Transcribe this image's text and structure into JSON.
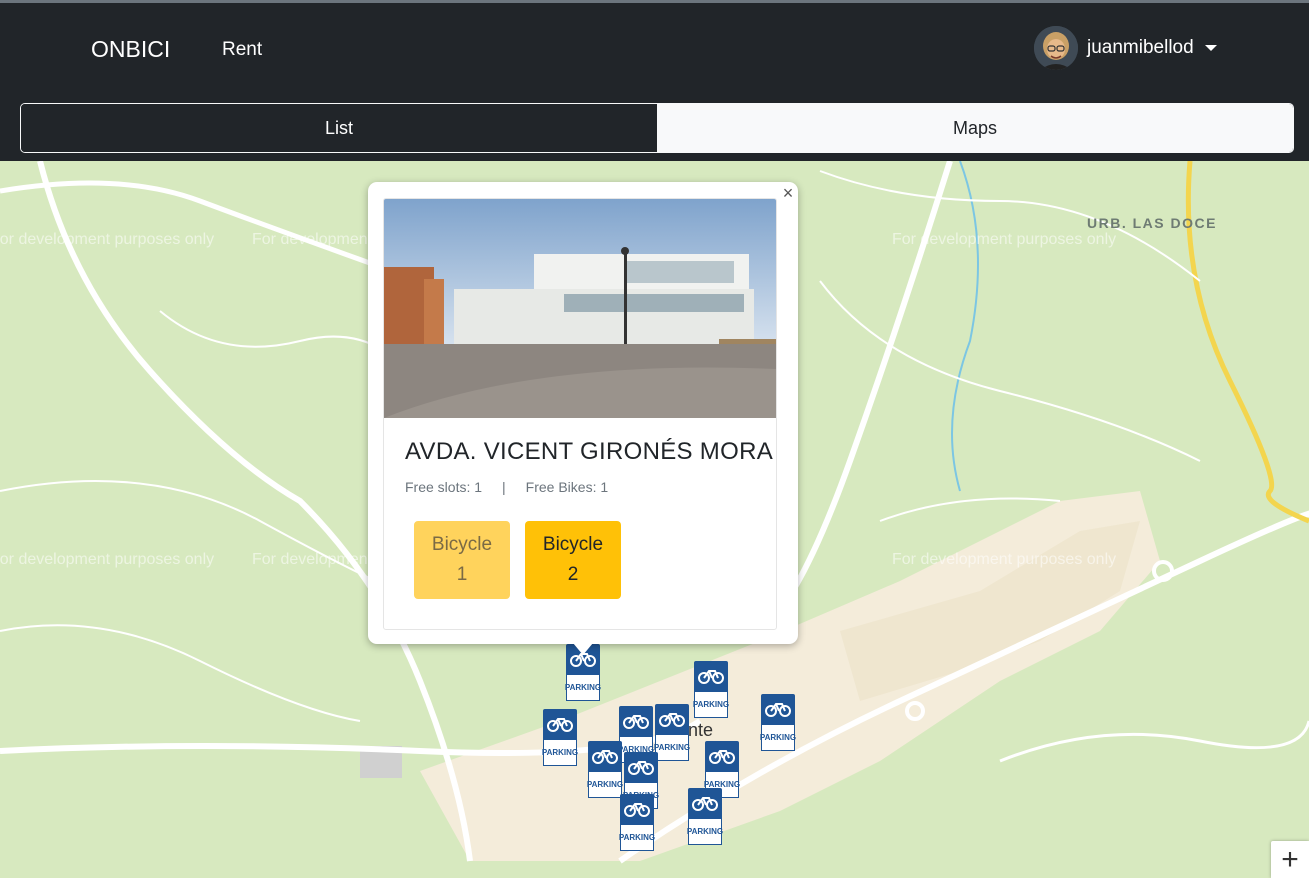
{
  "navbar": {
    "brand": "ONBICI",
    "links": [
      "Rent"
    ],
    "user": {
      "name": "juanmibellod",
      "avatar_icon": "user-avatar"
    }
  },
  "view_tabs": [
    {
      "label": "List",
      "active": false
    },
    {
      "label": "Maps",
      "active": true
    }
  ],
  "map": {
    "watermark": "For development purposes only",
    "labels": {
      "area": "URB. LAS DOCE",
      "town_fragment": "nte"
    },
    "marker_label": "PARKING",
    "marker_icon": "bicycle-parking-icon",
    "zoom_in": "+"
  },
  "popup": {
    "close_symbol": "×",
    "station": {
      "name": "AVDA. VICENT GIRONÉS MORA",
      "free_slots_label": "Free slots: 1",
      "separator": "|",
      "free_bikes_label": "Free Bikes: 1"
    },
    "bikes": [
      {
        "label": "Bicycle",
        "number": "1"
      },
      {
        "label": "Bicycle",
        "number": "2"
      }
    ]
  },
  "colors": {
    "navbar_bg": "#212529",
    "map_green": "#d7e9bf",
    "bike_button_light": "#ffd35c",
    "bike_button": "#ffc107",
    "parking_blue": "#1f5596"
  }
}
